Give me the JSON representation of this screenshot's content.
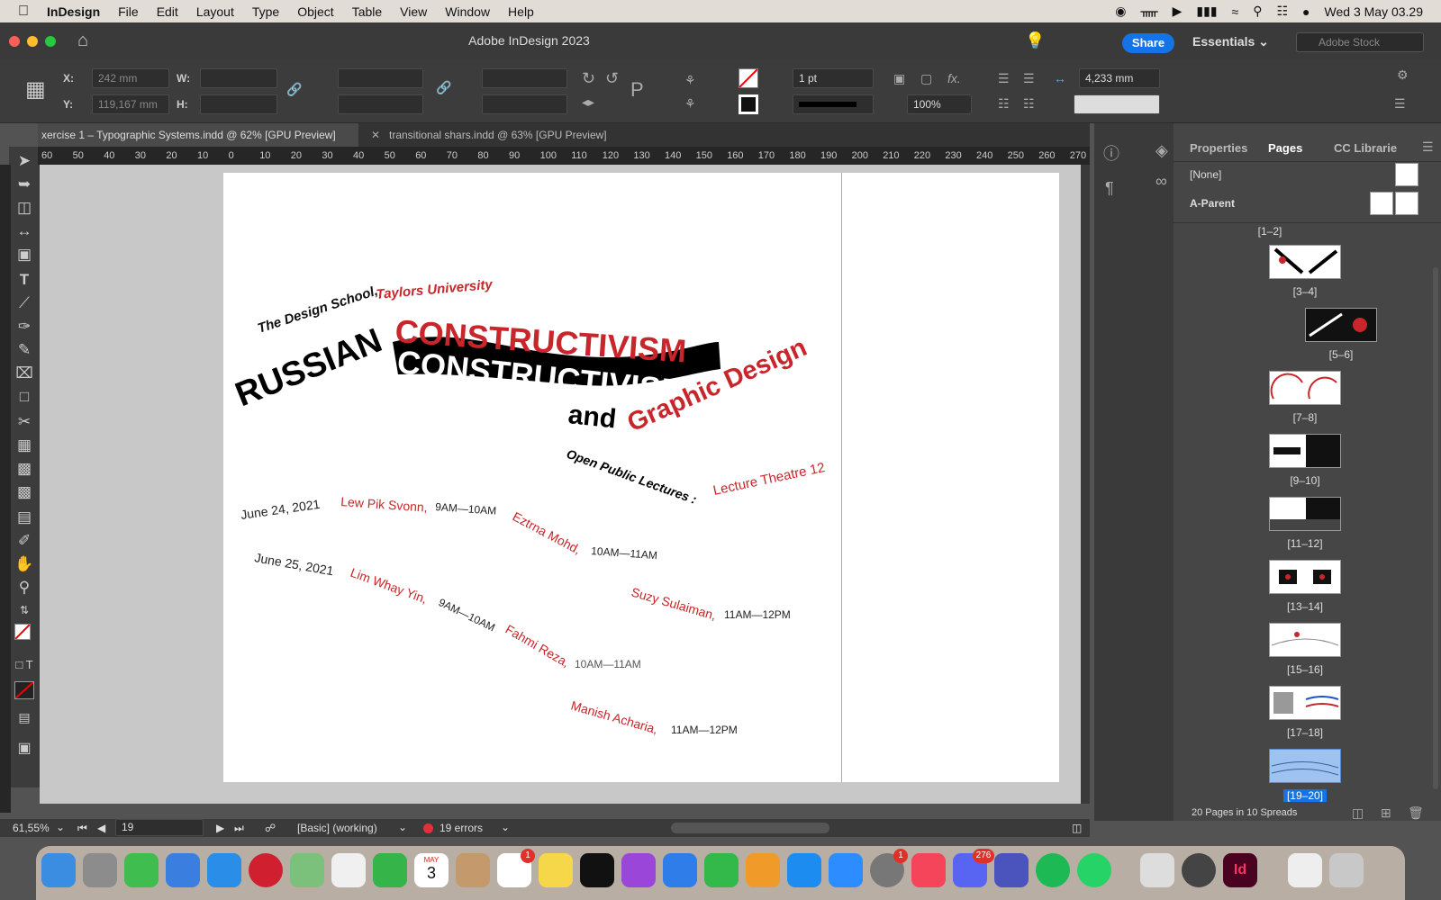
{
  "menubar": {
    "app": "InDesign",
    "items": [
      "File",
      "Edit",
      "Layout",
      "Type",
      "Object",
      "Table",
      "View",
      "Window",
      "Help"
    ],
    "clock": "Wed 3 May  03.29"
  },
  "titlebar": {
    "title": "Adobe InDesign 2023",
    "share": "Share",
    "workspace": "Essentials",
    "stock_placeholder": "Adobe Stock"
  },
  "control": {
    "x_label": "X:",
    "x_value": "242 mm",
    "y_label": "Y:",
    "y_value": "119,167 mm",
    "w_label": "W:",
    "h_label": "H:",
    "stroke_weight": "1 pt",
    "scale": "100%",
    "gutter": "4,233 mm"
  },
  "tabs": [
    {
      "label": "xercise 1 – Typographic Systems.indd @ 62% [GPU Preview]"
    },
    {
      "label": "transitional shars.indd @ 63% [GPU Preview]"
    }
  ],
  "ruler": [
    "60",
    "50",
    "40",
    "30",
    "20",
    "10",
    "0",
    "10",
    "20",
    "30",
    "40",
    "50",
    "60",
    "70",
    "80",
    "90",
    "100",
    "110",
    "120",
    "130",
    "140",
    "150",
    "160",
    "170",
    "180",
    "190",
    "200",
    "210",
    "220",
    "230",
    "240",
    "250",
    "260",
    "270"
  ],
  "poster": {
    "school": "The Design School,",
    "university": "Taylors University",
    "russian": "RUSSIAN",
    "constructivism": "CONSTRUCTIVISM",
    "and": "and",
    "graphic": "Graphic Design",
    "open": "Open Public Lectures :",
    "theatre": "Lecture Theatre 12",
    "d1": "June 24, 2021",
    "l1": "Lew Pik Svonn,",
    "t1": "9AM—10AM",
    "l2": "Eztrna Mohd,",
    "t2": "10AM—11AM",
    "d2": "June 25, 2021",
    "l3": "Lim Whay Yin,",
    "t3": "9AM—10AM",
    "l4": "Suzy Sulaiman,",
    "t4": "11AM—12PM",
    "l5": "Fahmi Reza,",
    "t5": "10AM—11AM",
    "l6": "Manish Acharia,",
    "t6": "11AM—12PM"
  },
  "status": {
    "zoom": "61,55%",
    "page": "19",
    "style": "[Basic] (working)",
    "errors": "19 errors"
  },
  "panel": {
    "tabs": [
      "Properties",
      "Pages",
      "CC Librarie"
    ],
    "none": "[None]",
    "parent": "A-Parent",
    "spreads": [
      "[1–2]",
      "[3–4]",
      "[5–6]",
      "[7–8]",
      "[9–10]",
      "[11–12]",
      "[13–14]",
      "[15–16]",
      "[17–18]",
      "[19–20]"
    ],
    "footer": "20 Pages in 10 Spreads"
  },
  "dock": {
    "calendar_month": "MAY",
    "calendar_day": "3",
    "badges": [
      "1",
      "1",
      "276"
    ]
  },
  "colors": {
    "accent": "#c8262a",
    "ui_bg": "#535353",
    "share": "#1473e6"
  }
}
